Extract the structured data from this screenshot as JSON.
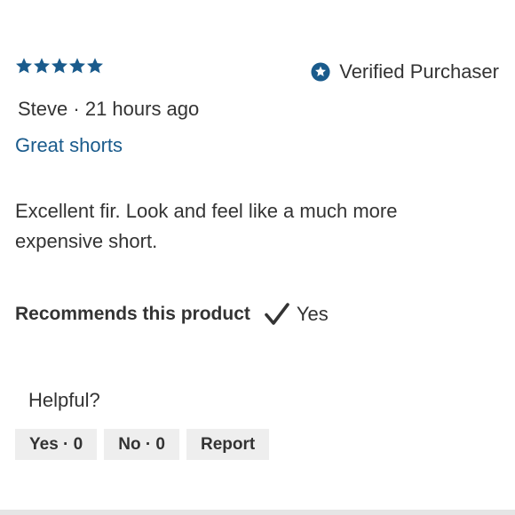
{
  "review": {
    "rating": 5,
    "rating_max": 5,
    "verified_label": "Verified Purchaser",
    "author": "Steve",
    "separator": " · ",
    "time_ago": "21 hours ago",
    "headline": "Great shorts",
    "body": "Excellent fir. Look and feel like a much more expensive short.",
    "recommends_label": "Recommends this product",
    "recommends_value": "Yes"
  },
  "helpful": {
    "label": "Helpful?",
    "yes_label": "Yes · 0",
    "no_label": "No · 0",
    "report_label": "Report"
  },
  "colors": {
    "accent": "#1a5b8c",
    "text": "#333333",
    "button_bg": "#eeeeee"
  },
  "icons": {
    "rating": "star-icon",
    "verified": "verified-star-badge-icon",
    "recommends": "checkmark-icon"
  }
}
